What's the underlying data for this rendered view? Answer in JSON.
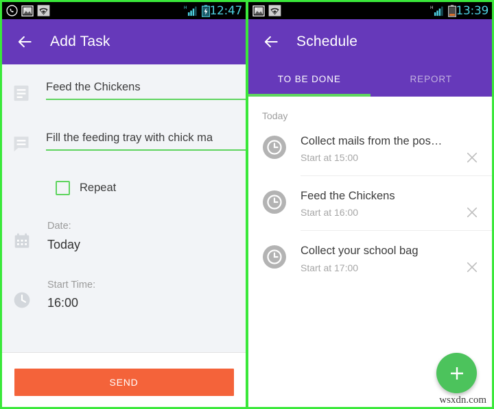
{
  "left_screen": {
    "status_bar": {
      "time": "12:47",
      "icons": [
        "whatsapp-icon",
        "image-icon",
        "wifi-icon"
      ],
      "right_icons": [
        "signal-icon",
        "battery-charging-icon"
      ]
    },
    "appbar": {
      "back_label": "back-arrow",
      "title": "Add Task"
    },
    "form": {
      "title_field": {
        "icon": "subject-icon",
        "value": "Feed the Chickens"
      },
      "description_field": {
        "icon": "comment-icon",
        "value": "Fill the feeding tray with chick ma"
      },
      "repeat": {
        "label": "Repeat",
        "checked": false
      },
      "date": {
        "icon": "calendar-icon",
        "label": "Date:",
        "value": "Today"
      },
      "start_time": {
        "icon": "clock-icon",
        "label": "Start Time:",
        "value": "16:00"
      }
    },
    "send_button": "SEND"
  },
  "right_screen": {
    "status_bar": {
      "time": "13:39",
      "icons": [
        "image-icon",
        "wifi-icon"
      ],
      "right_icons": [
        "signal-icon",
        "battery-icon"
      ]
    },
    "appbar": {
      "back_label": "back-arrow",
      "title": "Schedule"
    },
    "tabs": [
      {
        "label": "TO BE DONE",
        "active": true
      },
      {
        "label": "REPORT",
        "active": false
      }
    ],
    "list": {
      "section_label": "Today",
      "items": [
        {
          "icon": "clock-icon",
          "title": "Collect mails from the pos…",
          "subtitle": "Start at 15:00",
          "close": "close-icon"
        },
        {
          "icon": "clock-icon",
          "title": "Feed the Chickens",
          "subtitle": "Start at 16:00",
          "close": "close-icon"
        },
        {
          "icon": "clock-icon",
          "title": "Collect your school bag",
          "subtitle": "Start at 17:00",
          "close": "close-icon"
        }
      ]
    },
    "fab": "+",
    "watermark": "wsxdn.com"
  },
  "colors": {
    "purple": "#6639ba",
    "green": "#5ed45e",
    "fab_green": "#4cc35c",
    "orange": "#f4633a",
    "divider_green": "#3ae83a",
    "status_time": "#4dd0e1"
  }
}
